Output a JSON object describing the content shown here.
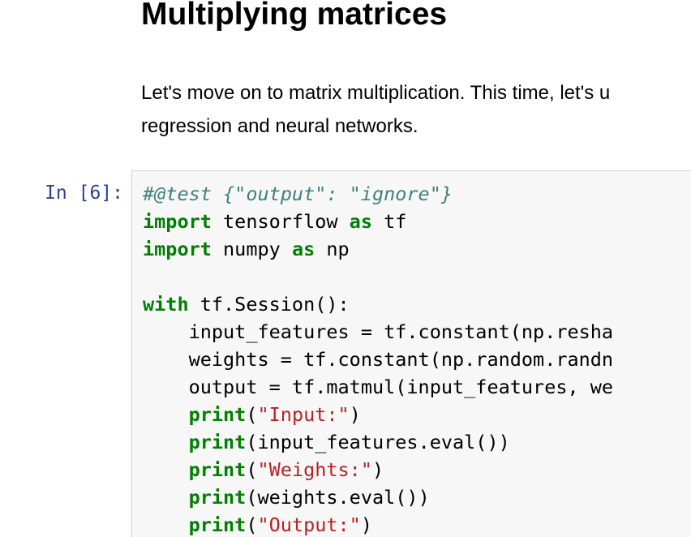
{
  "markdown": {
    "heading": "Multiplying matrices",
    "paragraph_line1": "Let's move on to matrix multiplication. This time, let's u",
    "paragraph_line2": "regression and neural networks."
  },
  "cell": {
    "prompt": "In [6]:",
    "lines": [
      {
        "indent": "",
        "tokens": [
          {
            "t": "#@test {\"output\": \"ignore\"}",
            "c": "cm"
          }
        ]
      },
      {
        "indent": "",
        "tokens": [
          {
            "t": "import",
            "c": "kw"
          },
          {
            "t": " tensorflow ",
            "c": ""
          },
          {
            "t": "as",
            "c": "kw"
          },
          {
            "t": " tf",
            "c": ""
          }
        ]
      },
      {
        "indent": "",
        "tokens": [
          {
            "t": "import",
            "c": "kw"
          },
          {
            "t": " numpy ",
            "c": ""
          },
          {
            "t": "as",
            "c": "kw"
          },
          {
            "t": " np",
            "c": ""
          }
        ]
      },
      {
        "indent": "",
        "tokens": []
      },
      {
        "indent": "",
        "tokens": [
          {
            "t": "with",
            "c": "kw"
          },
          {
            "t": " tf.Session():",
            "c": ""
          }
        ]
      },
      {
        "indent": "    ",
        "tokens": [
          {
            "t": "input_features = tf.constant(np.resha",
            "c": ""
          }
        ]
      },
      {
        "indent": "    ",
        "tokens": [
          {
            "t": "weights = tf.constant(np.random.randn",
            "c": ""
          }
        ]
      },
      {
        "indent": "    ",
        "tokens": [
          {
            "t": "output = tf.matmul(input_features, we",
            "c": ""
          }
        ]
      },
      {
        "indent": "    ",
        "tokens": [
          {
            "t": "print",
            "c": "kw"
          },
          {
            "t": "(",
            "c": ""
          },
          {
            "t": "\"Input:\"",
            "c": "st"
          },
          {
            "t": ")",
            "c": ""
          }
        ]
      },
      {
        "indent": "    ",
        "tokens": [
          {
            "t": "print",
            "c": "kw"
          },
          {
            "t": "(input_features.eval())",
            "c": ""
          }
        ]
      },
      {
        "indent": "    ",
        "tokens": [
          {
            "t": "print",
            "c": "kw"
          },
          {
            "t": "(",
            "c": ""
          },
          {
            "t": "\"Weights:\"",
            "c": "st"
          },
          {
            "t": ")",
            "c": ""
          }
        ]
      },
      {
        "indent": "    ",
        "tokens": [
          {
            "t": "print",
            "c": "kw"
          },
          {
            "t": "(weights.eval())",
            "c": ""
          }
        ]
      },
      {
        "indent": "    ",
        "tokens": [
          {
            "t": "print",
            "c": "kw"
          },
          {
            "t": "(",
            "c": ""
          },
          {
            "t": "\"Output:\"",
            "c": "st"
          },
          {
            "t": ")",
            "c": ""
          }
        ]
      }
    ]
  },
  "colors": {
    "prompt": "#303f9f",
    "keyword": "#008000",
    "string": "#ba2121",
    "comment": "#408080",
    "cell_background": "#f7f7f7",
    "cell_border": "#cfcfcf"
  }
}
